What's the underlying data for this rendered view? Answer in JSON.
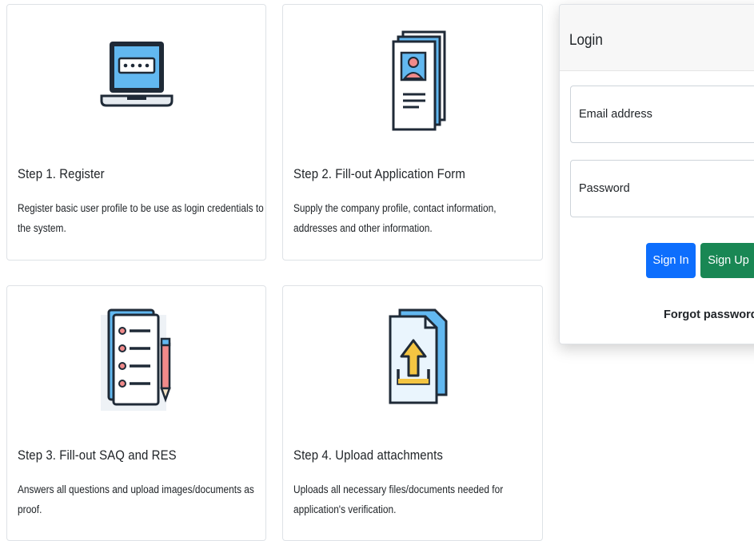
{
  "steps": [
    {
      "title": "Step 1. Register",
      "description": "Register basic user profile to be use as login credentials to the system.",
      "icon": "laptop-password-icon"
    },
    {
      "title": "Step 2. Fill-out Application Form",
      "description": "Supply the company profile, contact information, addresses and other information.",
      "icon": "id-document-icon"
    },
    {
      "title": "Step 3. Fill-out SAQ and RES",
      "description": "Answers all questions and upload images/documents as proof.",
      "icon": "checklist-pencil-icon"
    },
    {
      "title": "Step 4. Upload attachments",
      "description": "Uploads all necessary files/documents needed for application's verification.",
      "icon": "file-upload-icon"
    }
  ],
  "login": {
    "title": "Login",
    "email_placeholder": "Email address",
    "password_placeholder": "Password",
    "signin_label": "Sign In",
    "signup_label": "Sign Up",
    "forgot_label": "Forgot password?"
  },
  "colors": {
    "primary": "#0d6efd",
    "success": "#198754",
    "icon_blue": "#62b8f0",
    "icon_dark": "#1f2a37",
    "icon_red": "#f08a8a",
    "icon_yellow": "#f4c542"
  }
}
